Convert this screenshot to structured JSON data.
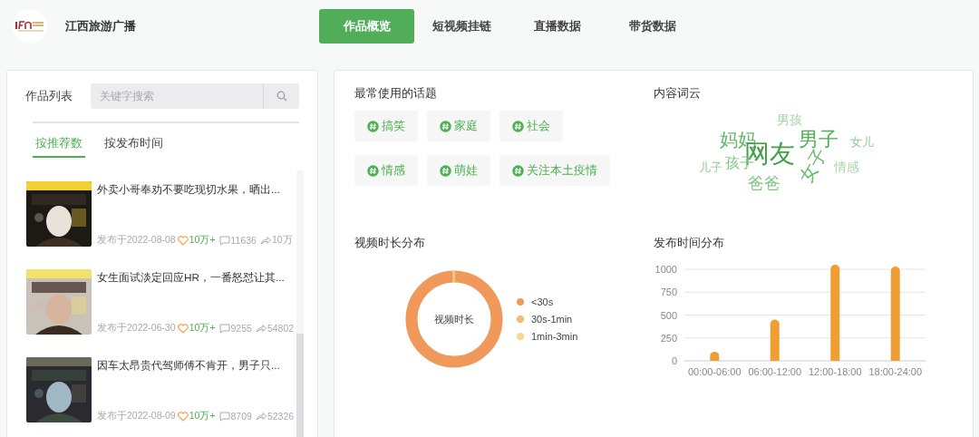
{
  "header": {
    "account_name": "江西旅游广播"
  },
  "nav_tabs": [
    {
      "label": "作品概览",
      "selected": true
    },
    {
      "label": "短视频挂链",
      "selected": false
    },
    {
      "label": "直播数据",
      "selected": false
    },
    {
      "label": "带货数据",
      "selected": false
    }
  ],
  "works_panel": {
    "title": "作品列表",
    "search": {
      "placeholder": "关键字搜索"
    },
    "sort_tabs": [
      {
        "label": "按推荐数",
        "selected": true
      },
      {
        "label": "按发布时间",
        "selected": false
      }
    ],
    "items": [
      {
        "title": "外卖小哥奉劝不要吃现切水果，晒出...",
        "date": "发布于2022-08-08",
        "likes": "10万+",
        "comments": "11636",
        "shares": "10万"
      },
      {
        "title": "女生面试淡定回应HR，一番怒怼让其...",
        "date": "发布于2022-06-30",
        "likes": "10万+",
        "comments": "9255",
        "shares": "54802"
      },
      {
        "title": "因车太昂贵代驾师傅不肯开，男子只...",
        "date": "发布于2022-08-09",
        "likes": "10万+",
        "comments": "8709",
        "shares": "52326"
      }
    ]
  },
  "topics": {
    "title": "最常使用的话题",
    "tags": [
      "搞笑",
      "家庭",
      "社会",
      "情感",
      "萌娃",
      "关注本土疫情"
    ]
  },
  "word_cloud": {
    "title": "内容词云",
    "words": [
      {
        "text": "男孩",
        "color": "#a5d6a7"
      },
      {
        "text": "妈妈",
        "color": "#66bb6a"
      },
      {
        "text": "网友",
        "color": "#43a047"
      },
      {
        "text": "男子",
        "color": "#4caf50"
      },
      {
        "text": "女儿",
        "color": "#8fcb92"
      },
      {
        "text": "儿子",
        "color": "#8fcb92"
      },
      {
        "text": "孩子",
        "color": "#81c784"
      },
      {
        "text": "女子",
        "color": "#66bb6a"
      },
      {
        "text": "情感",
        "color": "#a5d6a7"
      },
      {
        "text": "爸爸",
        "color": "#81c784"
      }
    ]
  },
  "duration": {
    "title": "视频时长分布",
    "center_label": "视频时长",
    "legend": [
      {
        "label": "<30s",
        "color": "#f0995a"
      },
      {
        "label": "30s-1min",
        "color": "#f5b877"
      },
      {
        "label": "1min-3min",
        "color": "#f7d78f"
      }
    ]
  },
  "publish_time": {
    "title": "发布时间分布",
    "chart_data": {
      "type": "bar",
      "categories": [
        "00:00-06:00",
        "06:00-12:00",
        "12:00-18:00",
        "18:00-24:00"
      ],
      "series": [
        {
          "color": "#f09e34",
          "values": [
            100,
            450,
            1050,
            1030
          ]
        }
      ],
      "ylim": [
        0,
        1050
      ],
      "yticks": [
        0,
        250,
        500,
        750,
        1000
      ],
      "grid": true
    }
  }
}
